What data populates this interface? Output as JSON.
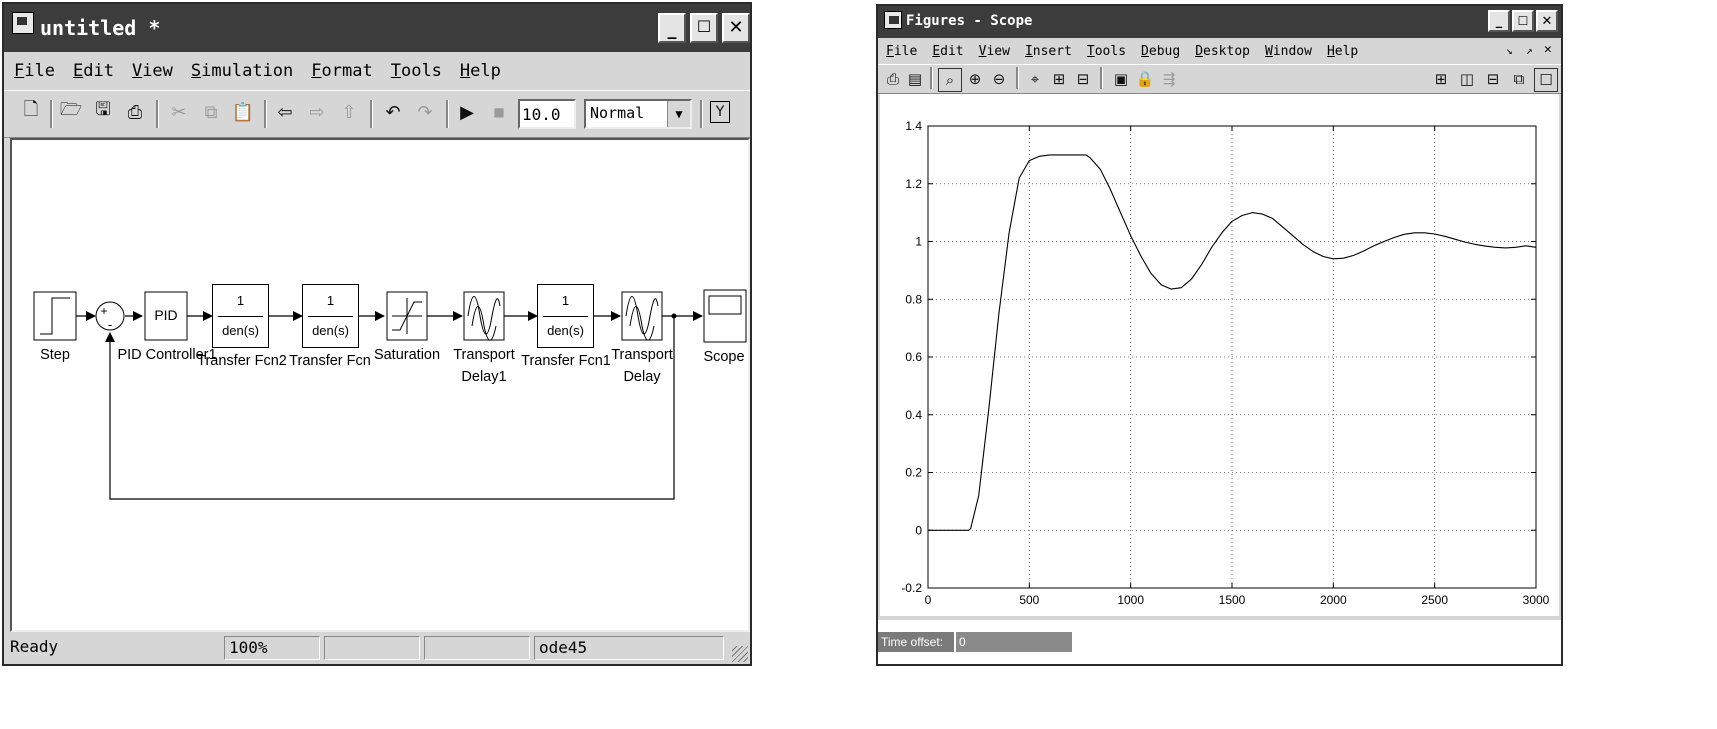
{
  "simulink": {
    "title": "untitled *",
    "menu": [
      "File",
      "Edit",
      "View",
      "Simulation",
      "Format",
      "Tools",
      "Help"
    ],
    "stop_time": "10.0",
    "sim_mode": "Normal",
    "blocks": {
      "step": "Step",
      "sum_plus": "+",
      "sum_minus": "-",
      "pid_text": "PID",
      "pid_label": "PID Controller1",
      "tf2_num": "1",
      "tf2_den": "den(s)",
      "tf2_label": "Transfer Fcn2",
      "tf_num": "1",
      "tf_den": "den(s)",
      "tf_label": "Transfer Fcn",
      "sat_label": "Saturation",
      "td1_label_1": "Transport",
      "td1_label_2": "Delay1",
      "tf1_num": "1",
      "tf1_den": "den(s)",
      "tf1_label": "Transfer Fcn1",
      "td_label_1": "Transport",
      "td_label_2": "Delay",
      "scope_label": "Scope"
    },
    "status": {
      "state": "Ready",
      "zoom": "100%",
      "cell3": "",
      "cell4": "",
      "solver": "ode45"
    }
  },
  "figure": {
    "title": "Figures - Scope",
    "menu": [
      "File",
      "Edit",
      "View",
      "Insert",
      "Tools",
      "Debug",
      "Desktop",
      "Window",
      "Help"
    ],
    "time_offset_label": "Time offset:",
    "time_offset_value": "0"
  },
  "chart_data": {
    "type": "line",
    "title": "",
    "xlabel": "",
    "ylabel": "",
    "xlim": [
      0,
      3000
    ],
    "ylim": [
      -0.2,
      1.4
    ],
    "xticks": [
      0,
      500,
      1000,
      1500,
      2000,
      2500,
      3000
    ],
    "yticks": [
      -0.2,
      0,
      0.2,
      0.4,
      0.6,
      0.8,
      1,
      1.2,
      1.4
    ],
    "ytick_labels": [
      "-0.2",
      "0",
      "0.2",
      "0.4",
      "0.6",
      "0.8",
      "1",
      "1.2",
      "1.4"
    ],
    "grid": true,
    "line_color": "#000000",
    "series": [
      {
        "x": [
          0,
          200,
          210,
          250,
          300,
          350,
          400,
          450,
          500,
          550,
          600,
          700,
          780,
          800,
          850,
          900,
          950,
          1000,
          1050,
          1100,
          1150,
          1200,
          1250,
          1300,
          1350,
          1400,
          1450,
          1500,
          1550,
          1600,
          1650,
          1700,
          1750,
          1800,
          1850,
          1900,
          1950,
          2000,
          2050,
          2100,
          2150,
          2200,
          2250,
          2300,
          2350,
          2400,
          2450,
          2500,
          2550,
          2600,
          2650,
          2700,
          2750,
          2800,
          2850,
          2900,
          2950,
          3000
        ],
        "y": [
          0,
          0,
          0.005,
          0.12,
          0.42,
          0.75,
          1.03,
          1.22,
          1.28,
          1.295,
          1.3,
          1.3,
          1.3,
          1.29,
          1.25,
          1.18,
          1.1,
          1.02,
          0.95,
          0.89,
          0.85,
          0.835,
          0.84,
          0.87,
          0.92,
          0.98,
          1.03,
          1.07,
          1.09,
          1.1,
          1.095,
          1.08,
          1.05,
          1.02,
          0.99,
          0.965,
          0.948,
          0.94,
          0.942,
          0.952,
          0.967,
          0.985,
          1.0,
          1.014,
          1.025,
          1.03,
          1.03,
          1.026,
          1.018,
          1.008,
          0.998,
          0.99,
          0.984,
          0.98,
          0.978,
          0.98,
          0.985,
          0.98
        ]
      }
    ]
  }
}
